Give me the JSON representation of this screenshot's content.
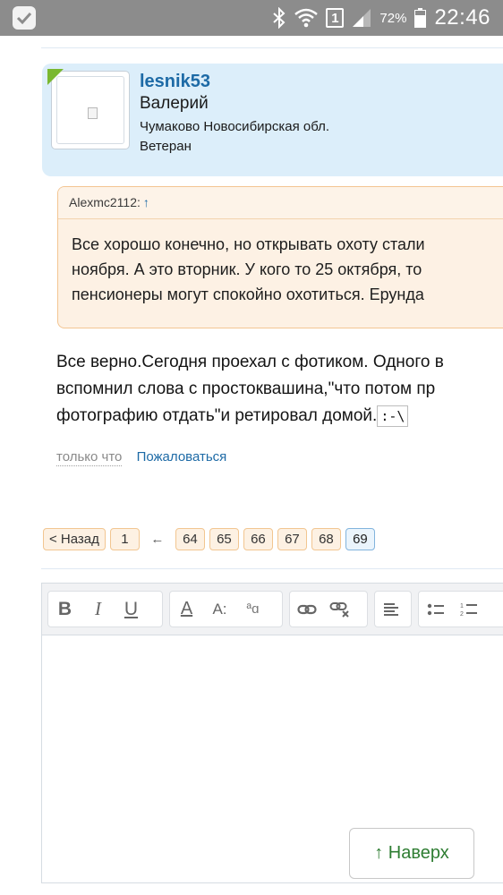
{
  "status_bar": {
    "battery_percent": "72%",
    "sim_label": "1",
    "time": "22:46",
    "icons": [
      "check-icon",
      "bluetooth-icon",
      "wifi-icon",
      "sim-icon",
      "signal-icon",
      "battery-icon"
    ]
  },
  "post": {
    "author": {
      "username": "lesnik53",
      "real_name": "Валерий",
      "location": "Чумаково Новосибирская обл.",
      "rank": "Ветеран",
      "online": true
    },
    "quote": {
      "author": "Alexmc2112:",
      "arrow": "↑",
      "lines": [
        "Все хорошо конечно, но открывать охоту стали",
        "ноября. А это вторник. У кого то 25 октября, то",
        "пенсионеры могут спокойно охотиться. Ерунда"
      ]
    },
    "text_lines": [
      "Все верно.Сегодня проехал с фотиком. Одного в",
      "вспомнил слова с простоквашина,\"что потом пр",
      "фотографию отдать\"и ретировал домой."
    ],
    "smiley": ":-\\",
    "time": "только что",
    "report_label": "Пожаловаться"
  },
  "pagination": {
    "prev_label": "< Назад",
    "first": "1",
    "separator": "←",
    "pages": [
      "64",
      "65",
      "66",
      "67",
      "68",
      "69"
    ],
    "current": "69"
  },
  "editor": {
    "toolbar": {
      "bold": "B",
      "italic": "I",
      "underline": "U",
      "font_color": "A",
      "font_size": "A:",
      "font_family": "ªɑ"
    }
  },
  "scroll_top_label": "↑ Наверх",
  "colors": {
    "status_bar": "#8c8c8c",
    "link": "#1d6aa6",
    "profile_bg": "#dceefa",
    "quote_bg": "#fdf1e4",
    "quote_border": "#f3c592",
    "online": "#7ab830",
    "scroll_top_text": "#2e7d32"
  }
}
